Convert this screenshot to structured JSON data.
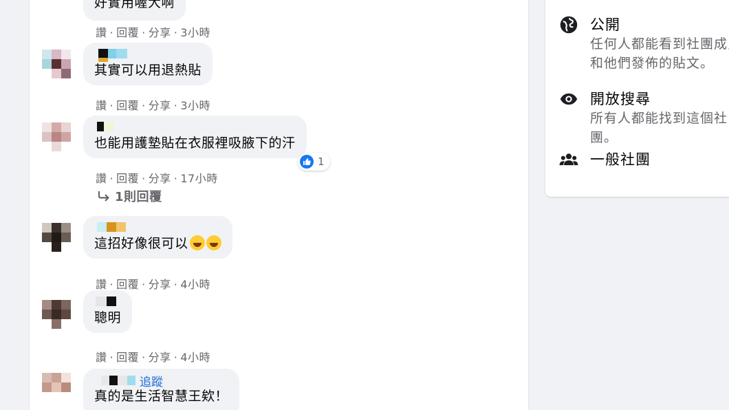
{
  "comments": [
    {
      "text": "好實用喔大啊",
      "actions": {
        "like": "讚",
        "reply": "回覆",
        "share": "分享",
        "time": "3小時"
      }
    },
    {
      "text": "其實可以用退熱貼",
      "actions": {
        "like": "讚",
        "reply": "回覆",
        "share": "分享",
        "time": "3小時"
      }
    },
    {
      "text": "也能用護墊貼在衣服裡吸腋下的汗",
      "actions": {
        "like": "讚",
        "reply": "回覆",
        "share": "分享",
        "time": "17小時"
      },
      "reactions": {
        "count": "1"
      },
      "replies_link": "1則回覆"
    },
    {
      "text": "這招好像很可以",
      "actions": {
        "like": "讚",
        "reply": "回覆",
        "share": "分享",
        "time": "4小時"
      }
    },
    {
      "text": "聰明",
      "actions": {
        "like": "讚",
        "reply": "回覆",
        "share": "分享",
        "time": "4小時"
      }
    },
    {
      "text": "真的是生活智慧王欸！",
      "follow": "追蹤"
    }
  ],
  "sidebar": {
    "privacy": {
      "icon": "globe-icon",
      "title": "公開",
      "desc": "任何人都能看到社團成員和他們發佈的貼文。"
    },
    "visibility": {
      "icon": "eye-icon",
      "title": "開放搜尋",
      "desc": "所有人都能找到這個社團。"
    },
    "group_type": {
      "icon": "people-icon",
      "title": "一般社團"
    }
  },
  "colors": {
    "background": "#f0f2f5",
    "bubble": "#f0f2f5",
    "secondary_text": "#65676b",
    "link": "#216fdb",
    "like_blue": "#1877f2"
  }
}
